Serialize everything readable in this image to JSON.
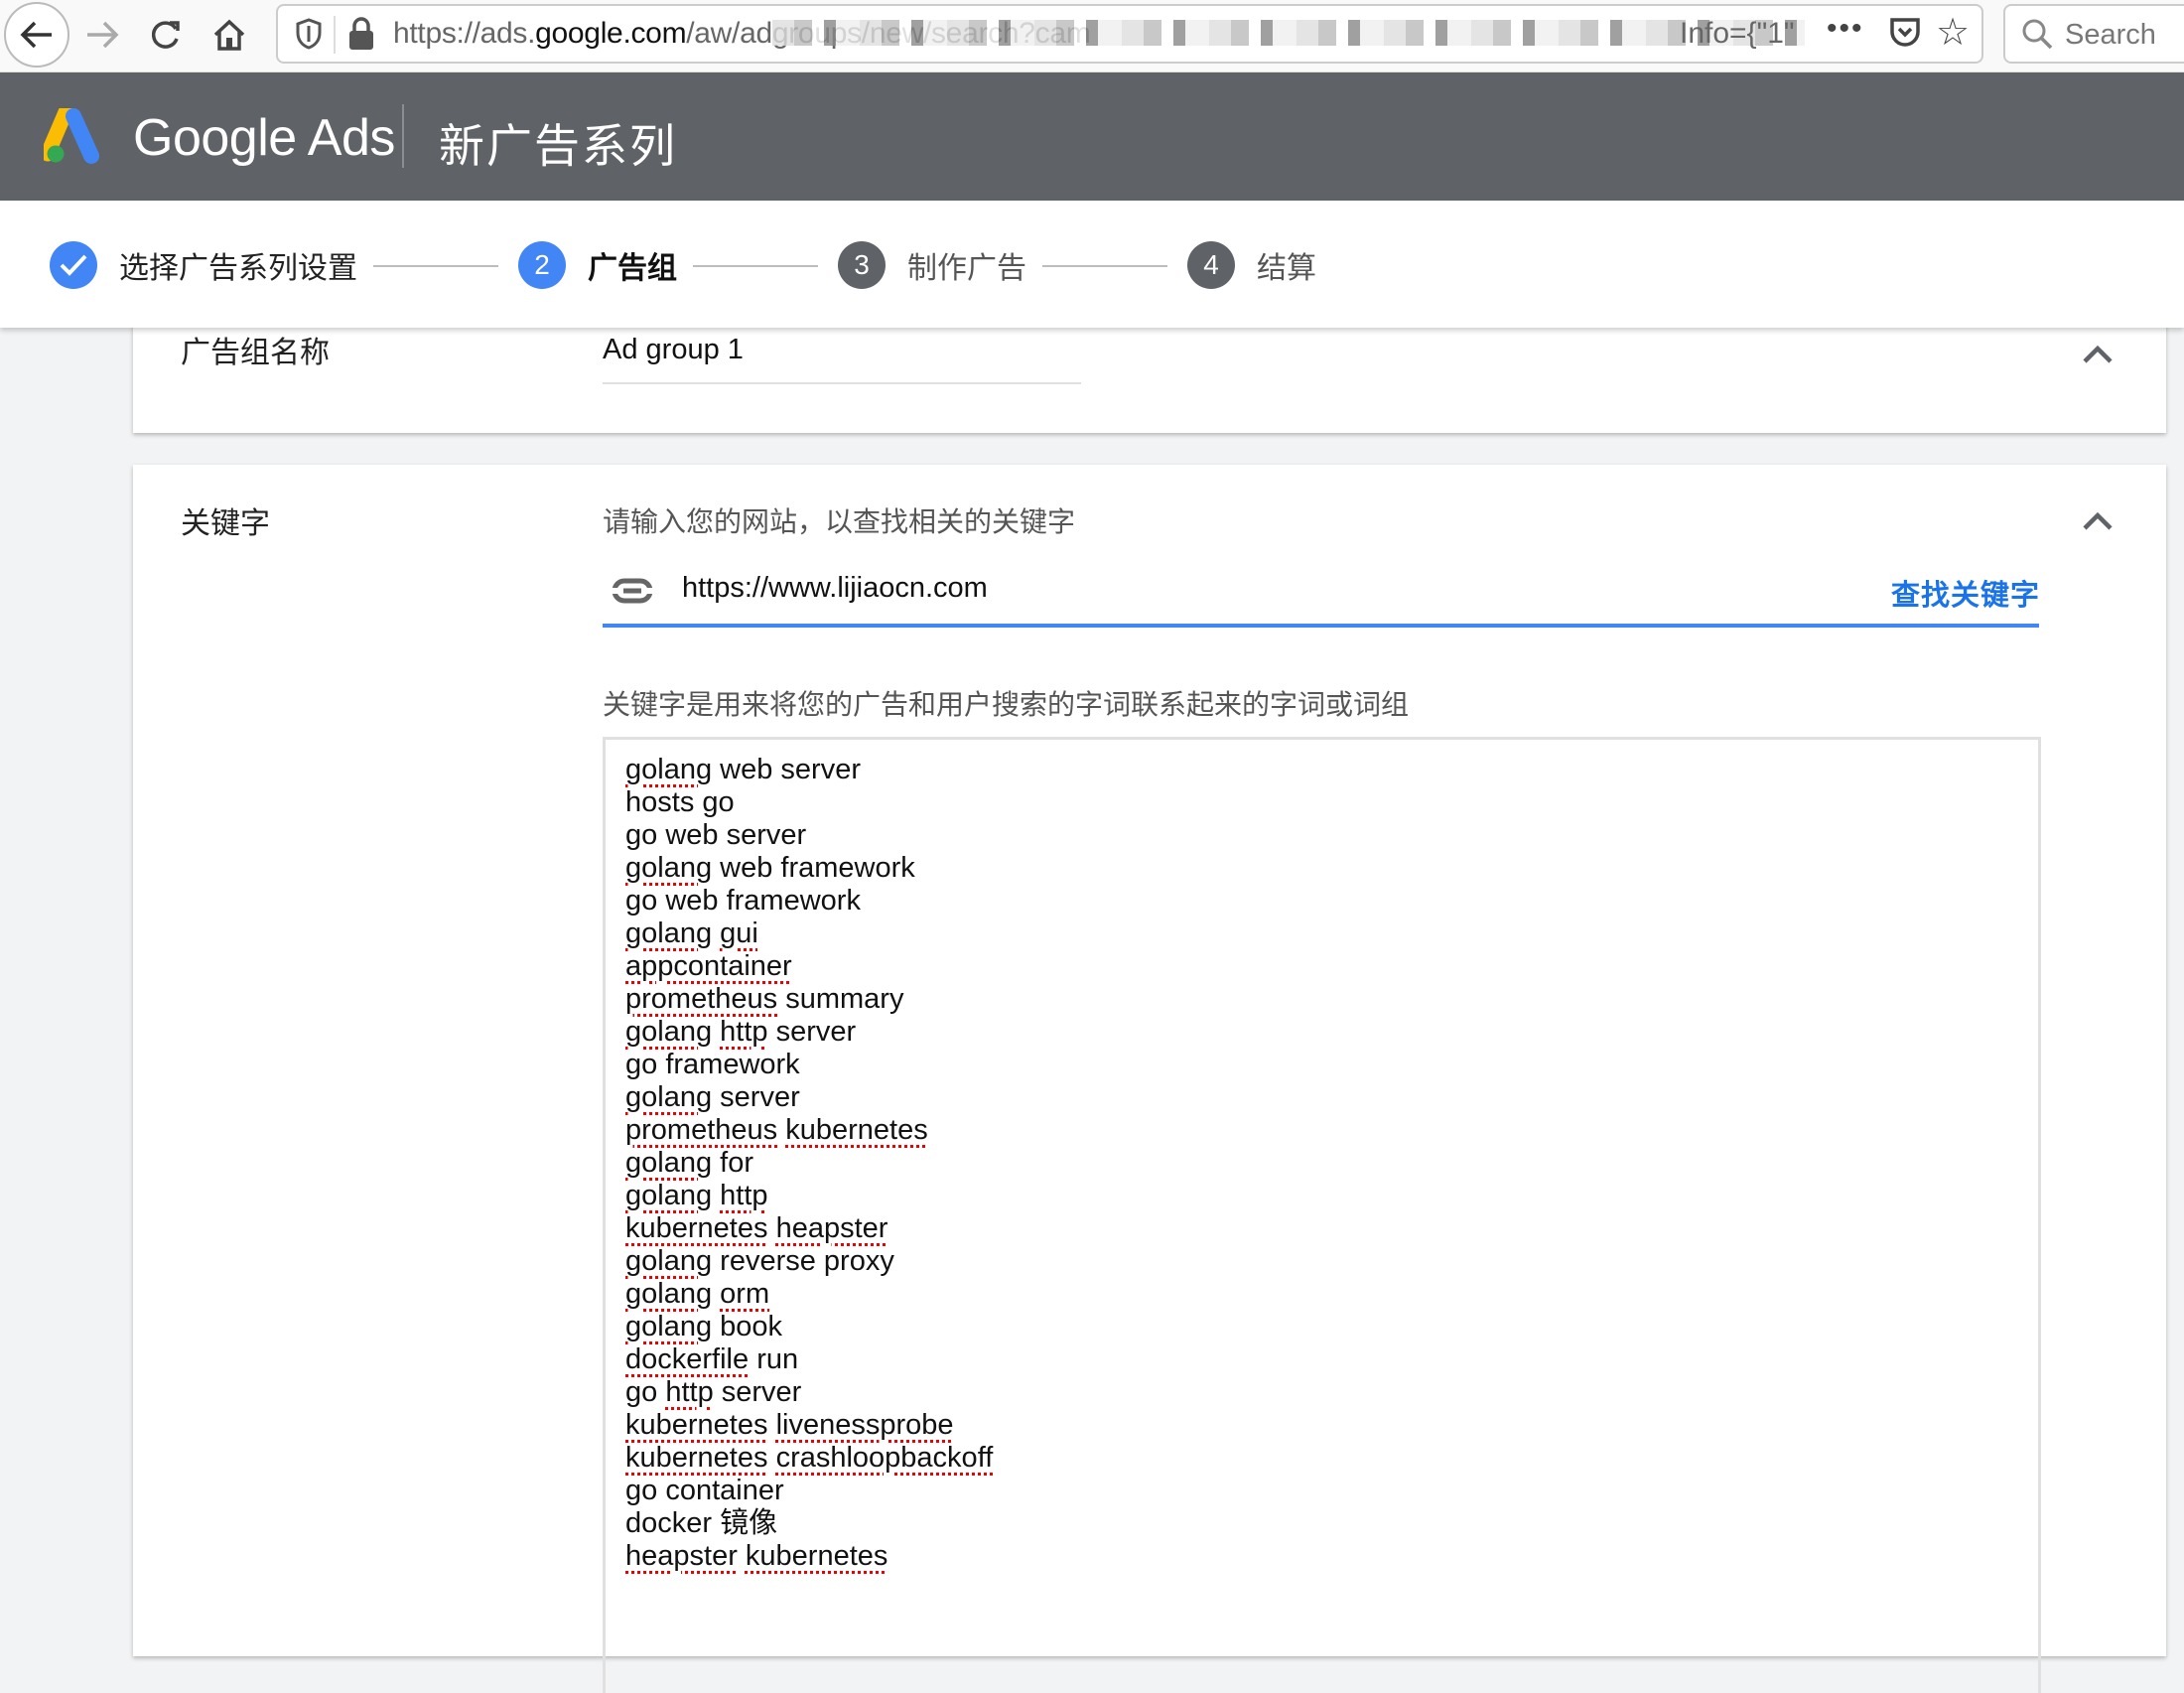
{
  "browser": {
    "url_prefix": "https://ads.",
    "url_domain": "google.com",
    "url_path": "/aw/adgroups/new/search?cam",
    "url_tail": "Info={\"1\"",
    "search_placeholder": "Search",
    "icons": [
      "back-icon",
      "forward-icon",
      "reload-icon",
      "home-icon",
      "tracking-shield-icon",
      "lock-icon",
      "more-icon",
      "pocket-icon",
      "bookmark-star-icon",
      "search-icon"
    ]
  },
  "header": {
    "brand": "Google Ads",
    "title": "新广告系列"
  },
  "stepper": {
    "steps": [
      {
        "number": "✓",
        "label": "选择广告系列设置",
        "state": "done"
      },
      {
        "number": "2",
        "label": "广告组",
        "state": "active"
      },
      {
        "number": "3",
        "label": "制作广告",
        "state": "pending"
      },
      {
        "number": "4",
        "label": "结算",
        "state": "pending"
      }
    ]
  },
  "ad_group": {
    "label": "广告组名称",
    "value": "Ad group 1"
  },
  "keywords": {
    "label": "关键字",
    "website_hint": "请输入您的网站，以查找相关的关键字",
    "website_value": "https://www.lijiaocn.com",
    "find_button": "查找关键字",
    "description": "关键字是用来将您的广告和用户搜索的字词联系起来的字词或词组",
    "list": [
      "golang web server",
      "hosts go",
      "go web server",
      "golang web framework",
      "go web framework",
      "golang gui",
      "appcontainer",
      "prometheus summary",
      "golang http server",
      "go framework",
      "golang server",
      "prometheus kubernetes",
      "golang for",
      "golang http",
      "kubernetes heapster",
      "golang reverse proxy",
      "golang orm",
      "golang book",
      "dockerfile run",
      "go http server",
      "kubernetes livenessprobe",
      "kubernetes crashloopbackoff",
      "go container",
      "docker 镜像",
      "heapster kubernetes"
    ],
    "misspelled": [
      "golang",
      "gui",
      "appcontainer",
      "prometheus",
      "http",
      "kubernetes",
      "heapster",
      "orm",
      "dockerfile",
      "livenessprobe",
      "crashloopbackoff"
    ]
  },
  "colors": {
    "accent": "#4285f4",
    "link": "#1a73e8",
    "header_bg": "#5f6368",
    "page_bg": "#f1f3f4"
  }
}
